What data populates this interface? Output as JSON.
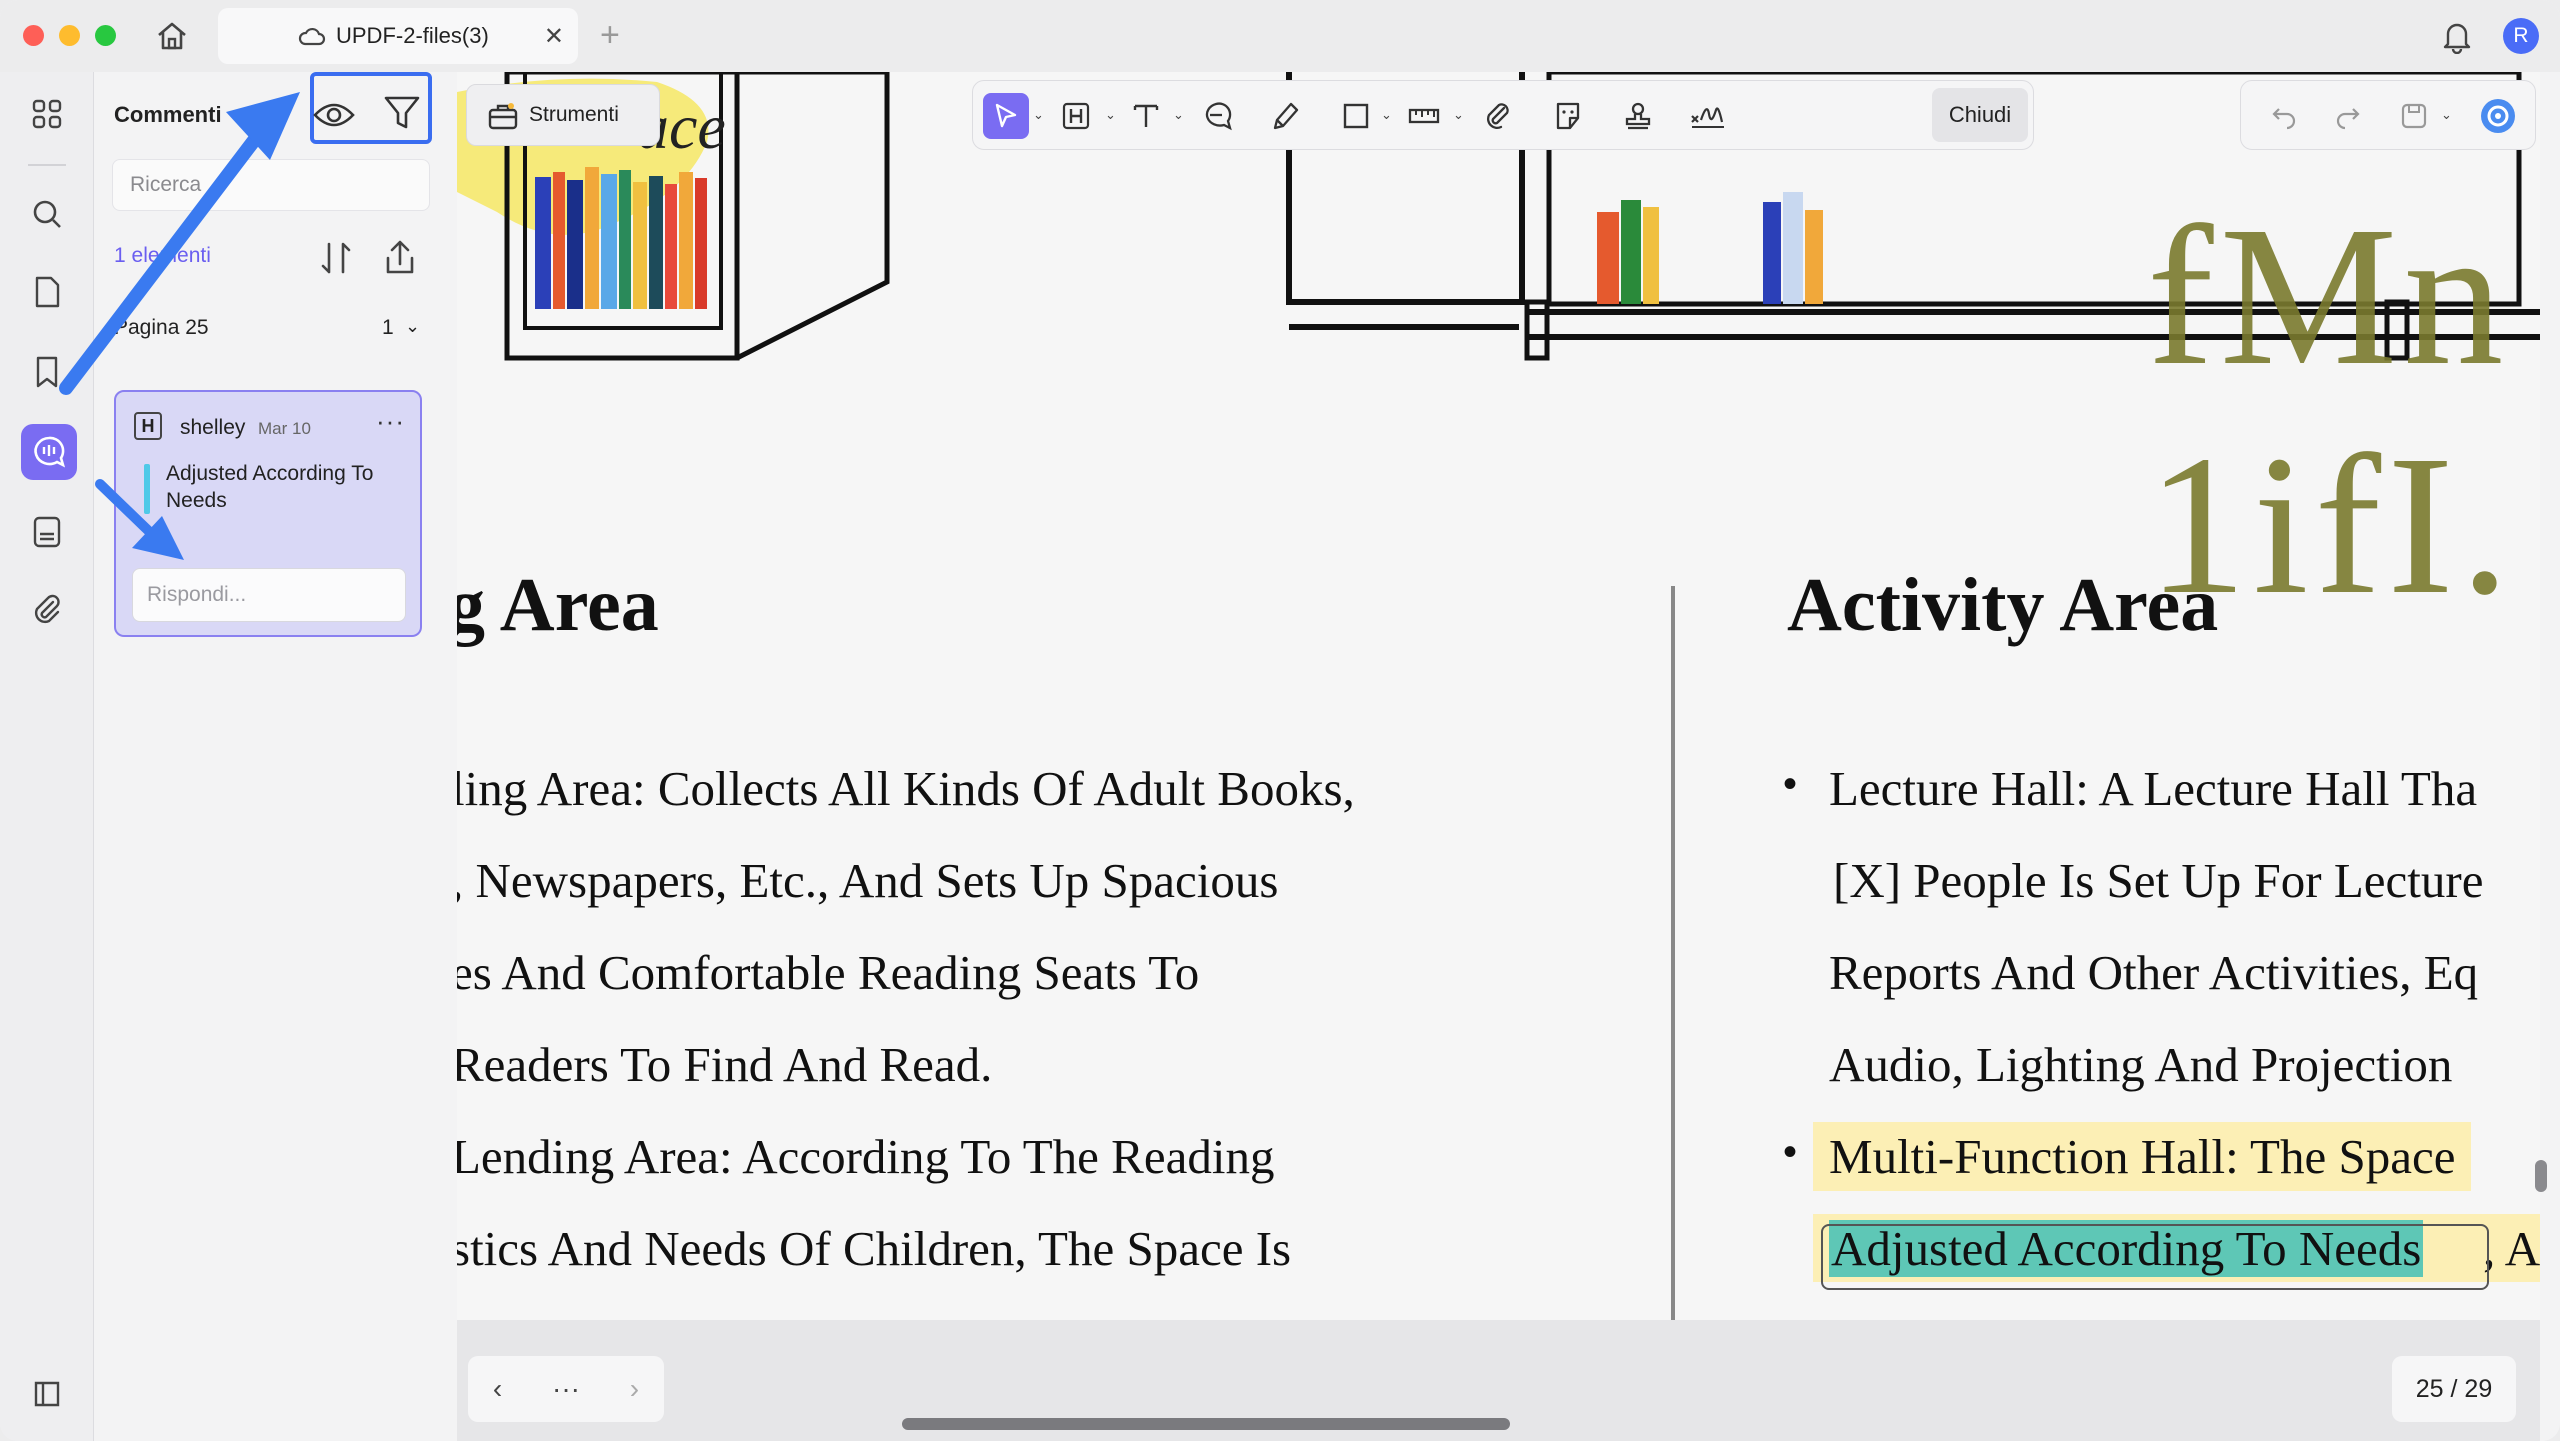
{
  "titlebar": {
    "tab_title": "UPDF-2-files(3)",
    "close_label": "✕",
    "add_label": "+",
    "avatar_initial": "R"
  },
  "sidebar_panel": {
    "title": "Commenti",
    "search_placeholder": "Ricerca",
    "count_label": "1 elementi",
    "page_label": "Pagina 25",
    "page_count": "1",
    "comment": {
      "user": "shelley",
      "date": "Mar 10",
      "text": "Adjusted According To Needs",
      "reply_placeholder": "Rispondi..."
    }
  },
  "toolbar": {
    "tools_label": "Strumenti",
    "close_label": "Chiudi"
  },
  "document": {
    "heading_left": "g Area",
    "heading_right": "Activity Area",
    "left_lines": [
      "ling Area: Collects All Kinds Of Adult Books,",
      ", Newspapers, Etc., And Sets Up Spacious",
      "es And Comfortable Reading Seats To",
      "Readers To Find And Read.",
      "Lending Area: According To The Reading",
      "stics And Needs Of Children, The Space Is"
    ],
    "right_lines": [
      "Lecture Hall: A Lecture Hall Tha",
      "[X] People Is Set Up For Lecture",
      "Reports And Other Activities, Eq",
      "Audio, Lighting And Projection",
      "Multi-Function Hall: The Space",
      "Adjusted According To Needs",
      ", A"
    ],
    "banner_text": "ace",
    "big_font_text": "fMn 1ifI."
  },
  "footer": {
    "prev": "‹",
    "more": "···",
    "next": "›",
    "page_indicator": "25  /  29"
  },
  "colors": {
    "accent": "#7a6cf2",
    "highlight_box": "#3a6df0",
    "yellow_highlight": "#fcefb5",
    "teal_highlight": "#5ec7b6"
  }
}
